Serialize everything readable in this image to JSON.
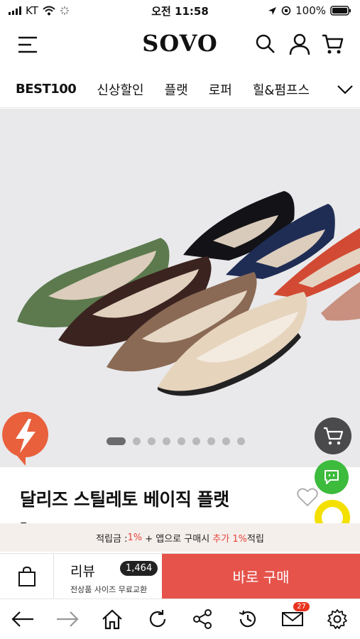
{
  "status": {
    "carrier": "KT",
    "time": "오전 11:58",
    "battery": "100%"
  },
  "header": {
    "logo": "SOVO",
    "icons": [
      "menu-icon",
      "search-icon",
      "user-icon",
      "cart-icon"
    ]
  },
  "nav": {
    "categories": [
      "BEST100",
      "신상할인",
      "플랫",
      "로퍼",
      "힐&펌프스"
    ]
  },
  "carousel": {
    "total": 9,
    "active": 1,
    "shoe_colors": [
      "#5c7a4e",
      "#111115",
      "#1e2d55",
      "#d24a33",
      "#c89080",
      "#3b2320",
      "#8a6a55",
      "#e6d4bd"
    ]
  },
  "product": {
    "title": "달리즈 스틸레토 베이직 플랫",
    "title_continued": "-"
  },
  "reward": {
    "label": "적립금 : ",
    "rate": "1%",
    "mid": " + 앱으로 구매시 ",
    "extra": "추가 1%",
    "suffix": "적립"
  },
  "buy_bar": {
    "review_label": "리뷰",
    "review_count": "1,464",
    "review_sub": "전상품 사이즈 무료교환",
    "buy_label": "바로 구매"
  },
  "browser": {
    "buttons": [
      "back-arrow-icon",
      "forward-arrow-icon",
      "home-icon",
      "reload-icon",
      "share-icon",
      "history-icon",
      "mail-icon",
      "settings-icon"
    ],
    "mail_badge": "27"
  },
  "colors": {
    "accent": "#e5534b",
    "chat_green": "#3dbb3d",
    "flash_orange": "#e8603c",
    "reward_bg": "#f5efec"
  }
}
